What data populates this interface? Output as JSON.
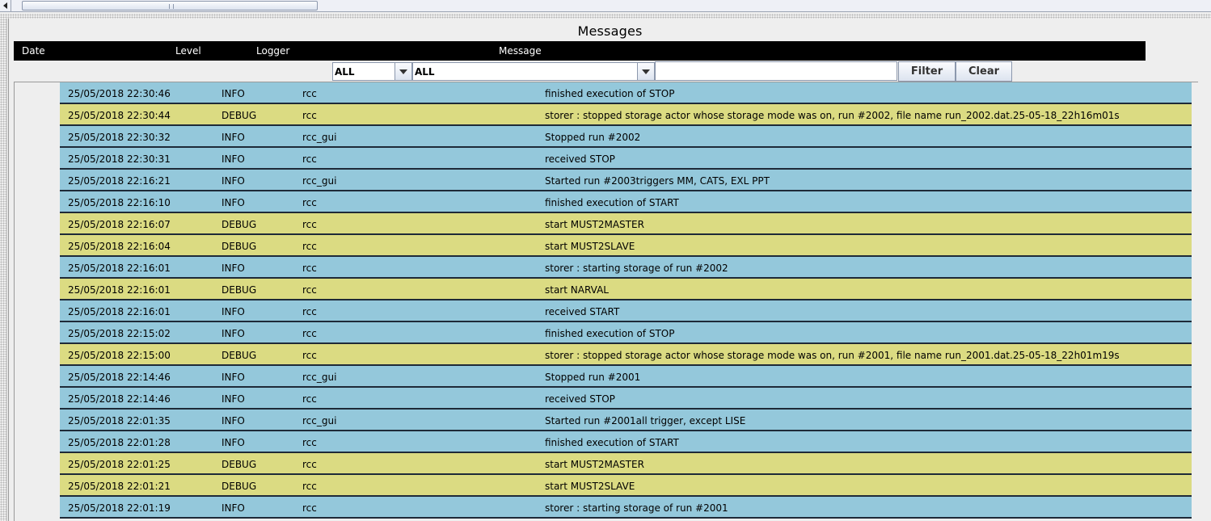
{
  "title": "Messages",
  "columns": {
    "date": "Date",
    "level": "Level",
    "logger": "Logger",
    "message": "Message"
  },
  "filters": {
    "level_value": "ALL",
    "logger_value": "ALL",
    "text_value": "",
    "filter_label": "Filter",
    "clear_label": "Clear"
  },
  "colors": {
    "info_row": "#94c8db",
    "debug_row": "#dbdb82",
    "header_bg": "#000000"
  },
  "rows": [
    {
      "date": "25/05/2018 22:30:46",
      "level": "INFO",
      "logger": "rcc",
      "message": "finished execution of STOP"
    },
    {
      "date": "25/05/2018 22:30:44",
      "level": "DEBUG",
      "logger": "rcc",
      "message": "storer : stopped storage actor whose storage mode was on, run #2002, file name run_2002.dat.25-05-18_22h16m01s"
    },
    {
      "date": "25/05/2018 22:30:32",
      "level": "INFO",
      "logger": "rcc_gui",
      "message": "Stopped run #2002"
    },
    {
      "date": "25/05/2018 22:30:31",
      "level": "INFO",
      "logger": "rcc",
      "message": "received STOP"
    },
    {
      "date": "25/05/2018 22:16:21",
      "level": "INFO",
      "logger": "rcc_gui",
      "message": "Started run #2003triggers MM, CATS, EXL PPT"
    },
    {
      "date": "25/05/2018 22:16:10",
      "level": "INFO",
      "logger": "rcc",
      "message": "finished execution of START"
    },
    {
      "date": "25/05/2018 22:16:07",
      "level": "DEBUG",
      "logger": "rcc",
      "message": "start MUST2MASTER"
    },
    {
      "date": "25/05/2018 22:16:04",
      "level": "DEBUG",
      "logger": "rcc",
      "message": "start MUST2SLAVE"
    },
    {
      "date": "25/05/2018 22:16:01",
      "level": "INFO",
      "logger": "rcc",
      "message": "storer : starting storage of run #2002"
    },
    {
      "date": "25/05/2018 22:16:01",
      "level": "DEBUG",
      "logger": "rcc",
      "message": "start NARVAL"
    },
    {
      "date": "25/05/2018 22:16:01",
      "level": "INFO",
      "logger": "rcc",
      "message": "received START"
    },
    {
      "date": "25/05/2018 22:15:02",
      "level": "INFO",
      "logger": "rcc",
      "message": "finished execution of STOP"
    },
    {
      "date": "25/05/2018 22:15:00",
      "level": "DEBUG",
      "logger": "rcc",
      "message": "storer : stopped storage actor whose storage mode was on, run #2001, file name run_2001.dat.25-05-18_22h01m19s"
    },
    {
      "date": "25/05/2018 22:14:46",
      "level": "INFO",
      "logger": "rcc_gui",
      "message": "Stopped run #2001"
    },
    {
      "date": "25/05/2018 22:14:46",
      "level": "INFO",
      "logger": "rcc",
      "message": "received STOP"
    },
    {
      "date": "25/05/2018 22:01:35",
      "level": "INFO",
      "logger": "rcc_gui",
      "message": "Started run #2001all trigger, except LISE"
    },
    {
      "date": "25/05/2018 22:01:28",
      "level": "INFO",
      "logger": "rcc",
      "message": "finished execution of START"
    },
    {
      "date": "25/05/2018 22:01:25",
      "level": "DEBUG",
      "logger": "rcc",
      "message": "start MUST2MASTER"
    },
    {
      "date": "25/05/2018 22:01:21",
      "level": "DEBUG",
      "logger": "rcc",
      "message": "start MUST2SLAVE"
    },
    {
      "date": "25/05/2018 22:01:19",
      "level": "INFO",
      "logger": "rcc",
      "message": "storer : starting storage of run #2001"
    }
  ]
}
